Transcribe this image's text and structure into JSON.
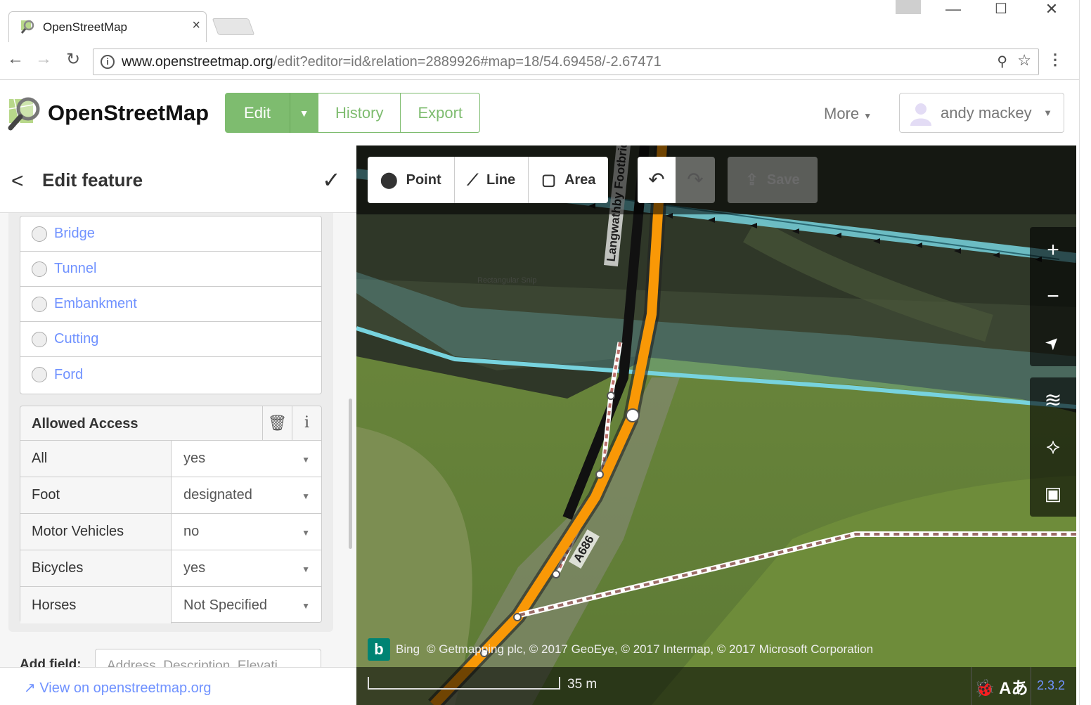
{
  "browser": {
    "tab_title": "OpenStreetMap",
    "tab_close": "×",
    "url_domain": "www.openstreetmap.org",
    "url_path": "/edit?editor=id&relation=2889926#map=18/54.69458/-2.67471",
    "back": "←",
    "forward": "→",
    "reload": "↻",
    "menu": "⋮",
    "info": "i",
    "zoom": "⚲",
    "star": "☆",
    "window_controls": [
      "—",
      "☐",
      "✕"
    ]
  },
  "header": {
    "brand": "OpenStreetMap",
    "edit_label": "Edit",
    "edit_caret": "▼",
    "history_label": "History",
    "export_label": "Export",
    "more_label": "More",
    "more_caret": "▼",
    "user_name": "andy mackey",
    "user_caret": "▼"
  },
  "sidebar": {
    "title": "Edit feature",
    "back": "<",
    "done": "✓",
    "structure_options": [
      "Bridge",
      "Tunnel",
      "Embankment",
      "Cutting",
      "Ford"
    ],
    "access": {
      "title": "Allowed Access",
      "trash": "🗑",
      "info": "i",
      "rows": [
        {
          "key": "All",
          "value": "yes"
        },
        {
          "key": "Foot",
          "value": "designated"
        },
        {
          "key": "Motor Vehicles",
          "value": "no"
        },
        {
          "key": "Bicycles",
          "value": "yes"
        },
        {
          "key": "Horses",
          "value": "Not Specified"
        }
      ]
    },
    "add_field_label": "Add field:",
    "add_field_placeholder": "Address, Description, Elevati",
    "view_link": "View on openstreetmap.org",
    "view_link_icon": "↗"
  },
  "map": {
    "tools": {
      "point": "Point",
      "line": "Line",
      "area": "Area",
      "undo": "↶",
      "redo": "↷",
      "save": "Save"
    },
    "tool_icons": {
      "point": "⬤",
      "line": "⟋",
      "area": "▢",
      "save": "⇪"
    },
    "controls": {
      "zoom_in": "+",
      "zoom_out": "−",
      "locate": "➤",
      "layers": "≋",
      "map_data": "⟡",
      "help": "▣"
    },
    "labels": {
      "footbridge": "Langwathby Footbridge",
      "a686": "A686",
      "snip": "Rectangular Snip"
    },
    "attribution": {
      "bing_logo": "b",
      "bing": "Bing",
      "text": "© Getmapping plc, © 2017 GeoEye, © 2017 Intermap, © 2017 Microsoft Corporation"
    },
    "scale": "35 m",
    "footer_tools": "🐞 Aあ",
    "version": "2.3.2"
  },
  "colors": {
    "osm_green": "#7ebc6f",
    "link_blue": "#7092ff",
    "road_orange": "#f99806",
    "river_blue": "#77d3de"
  }
}
